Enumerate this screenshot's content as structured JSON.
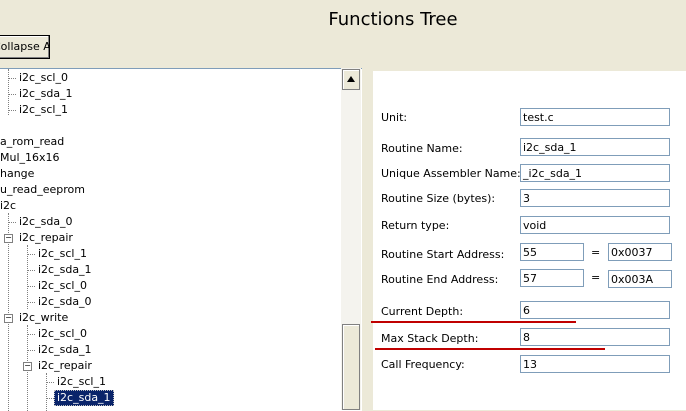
{
  "window": {
    "title": "Functions Tree"
  },
  "toolbar": {
    "collapse_all_label": "Collapse All"
  },
  "tree": {
    "nodes": [
      "i2c_scl_0",
      "i2c_sda_1",
      "i2c_scl_1",
      "a_rom_read",
      "Mul_16x16",
      "hange",
      "u_read_eeprom",
      "i2c",
      "i2c_sda_0",
      "i2c_repair",
      "i2c_scl_1",
      "i2c_sda_1",
      "i2c_scl_0",
      "i2c_sda_0",
      "i2c_write",
      "i2c_scl_0",
      "i2c_sda_1",
      "i2c_repair",
      "i2c_scl_1",
      "i2c_sda_1"
    ],
    "selected": "i2c_sda_1"
  },
  "properties": {
    "unit": {
      "label": "Unit:",
      "value": "test.c"
    },
    "routine_name": {
      "label": "Routine Name:",
      "value": "i2c_sda_1"
    },
    "unique_asm_name": {
      "label": "Unique Assembler Name:",
      "value": "_i2c_sda_1"
    },
    "routine_size": {
      "label": "Routine Size (bytes):",
      "value": "3"
    },
    "return_type": {
      "label": "Return type:",
      "value": "void"
    },
    "start_address": {
      "label": "Routine Start Address:",
      "dec": "55",
      "eq": "=",
      "hex": "0x0037"
    },
    "end_address": {
      "label": "Routine End Address:",
      "dec": "57",
      "eq": "=",
      "hex": "0x003A"
    },
    "current_depth": {
      "label": "Current Depth:",
      "value": "6"
    },
    "max_stack_depth": {
      "label": "Max Stack Depth:",
      "value": "8"
    },
    "call_frequency": {
      "label": "Call Frequency:",
      "value": "13"
    }
  },
  "colors": {
    "highlight_line": "#c00000",
    "selection": "#0a246a"
  }
}
